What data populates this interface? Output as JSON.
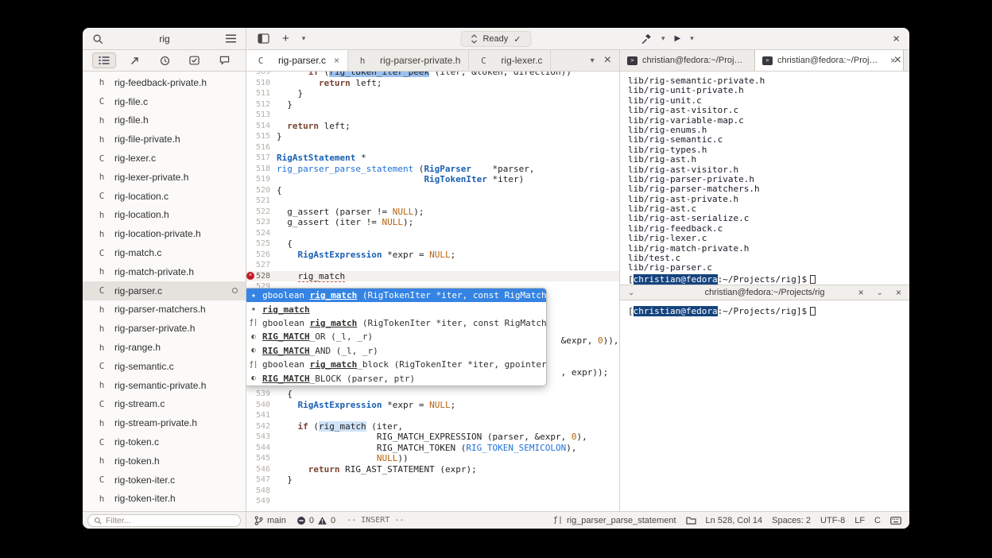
{
  "icons": {
    "plus": "+",
    "chevron": "▾",
    "chevron_small": "⌄",
    "run": "▶",
    "close": "×",
    "check": "✓",
    "star": "★",
    "function": "ƒ|",
    "macro": "◐",
    "prompt_char": ">"
  },
  "header": {
    "project": "rig",
    "ready": "Ready"
  },
  "sidebar": {
    "filter_placeholder": "Filter...",
    "selected": "rig-parser.c",
    "files": [
      {
        "type": "h",
        "name": "rig-feedback-private.h"
      },
      {
        "type": "C",
        "name": "rig-file.c"
      },
      {
        "type": "h",
        "name": "rig-file.h"
      },
      {
        "type": "h",
        "name": "rig-file-private.h"
      },
      {
        "type": "C",
        "name": "rig-lexer.c"
      },
      {
        "type": "h",
        "name": "rig-lexer-private.h"
      },
      {
        "type": "C",
        "name": "rig-location.c"
      },
      {
        "type": "h",
        "name": "rig-location.h"
      },
      {
        "type": "h",
        "name": "rig-location-private.h"
      },
      {
        "type": "C",
        "name": "rig-match.c"
      },
      {
        "type": "h",
        "name": "rig-match-private.h"
      },
      {
        "type": "C",
        "name": "rig-parser.c"
      },
      {
        "type": "h",
        "name": "rig-parser-matchers.h"
      },
      {
        "type": "h",
        "name": "rig-parser-private.h"
      },
      {
        "type": "h",
        "name": "rig-range.h"
      },
      {
        "type": "C",
        "name": "rig-semantic.c"
      },
      {
        "type": "h",
        "name": "rig-semantic-private.h"
      },
      {
        "type": "C",
        "name": "rig-stream.c"
      },
      {
        "type": "h",
        "name": "rig-stream-private.h"
      },
      {
        "type": "C",
        "name": "rig-token.c"
      },
      {
        "type": "h",
        "name": "rig-token.h"
      },
      {
        "type": "C",
        "name": "rig-token-iter.c"
      },
      {
        "type": "h",
        "name": "rig-token-iter.h"
      }
    ]
  },
  "editor": {
    "current_line": 528,
    "tabs": [
      {
        "icon": "C",
        "label": "rig-parser.c",
        "active": true,
        "close": true
      },
      {
        "icon": "h",
        "label": "rig-parser-private.h",
        "active": false,
        "close": false
      },
      {
        "icon": "C",
        "label": "rig-lexer.c",
        "active": false,
        "close": false
      }
    ],
    "lines": [
      {
        "n": 509,
        "s": [
          [
            "      ",
            ""
          ],
          [
            "if",
            "k"
          ],
          [
            " (",
            ""
          ],
          [
            "rig_token_iter_peek",
            "s"
          ],
          [
            " (iter, &token, direction))",
            ""
          ]
        ]
      },
      {
        "n": 510,
        "s": [
          [
            "        ",
            ""
          ],
          [
            "return",
            "k"
          ],
          [
            " left;",
            ""
          ]
        ]
      },
      {
        "n": 511,
        "s": [
          [
            "    }",
            ""
          ]
        ]
      },
      {
        "n": 512,
        "s": [
          [
            "  }",
            ""
          ]
        ]
      },
      {
        "n": 513,
        "s": []
      },
      {
        "n": 514,
        "s": [
          [
            "  ",
            ""
          ],
          [
            "return",
            "k"
          ],
          [
            " left;",
            ""
          ]
        ]
      },
      {
        "n": 515,
        "s": [
          [
            "}",
            ""
          ]
        ]
      },
      {
        "n": 516,
        "s": []
      },
      {
        "n": 517,
        "s": [
          [
            "RigAstStatement",
            "t"
          ],
          [
            " *",
            ""
          ]
        ]
      },
      {
        "n": 518,
        "s": [
          [
            "rig_parser_parse_statement",
            "f"
          ],
          [
            " (",
            ""
          ],
          [
            "RigParser",
            "t"
          ],
          [
            "    *parser,",
            ""
          ]
        ]
      },
      {
        "n": 519,
        "s": [
          [
            "                            ",
            ""
          ],
          [
            "RigTokenIter",
            "t"
          ],
          [
            " *iter)",
            ""
          ]
        ]
      },
      {
        "n": 520,
        "s": [
          [
            "{",
            ""
          ]
        ]
      },
      {
        "n": 521,
        "s": []
      },
      {
        "n": 522,
        "s": [
          [
            "  g_assert (parser != ",
            ""
          ],
          [
            "NULL",
            "c"
          ],
          [
            ");",
            ""
          ]
        ]
      },
      {
        "n": 523,
        "s": [
          [
            "  g_assert (iter != ",
            ""
          ],
          [
            "NULL",
            "c"
          ],
          [
            ");",
            ""
          ]
        ]
      },
      {
        "n": 524,
        "s": []
      },
      {
        "n": 525,
        "s": [
          [
            "  {",
            ""
          ]
        ]
      },
      {
        "n": 526,
        "s": [
          [
            "    ",
            ""
          ],
          [
            "RigAstExpression",
            "t"
          ],
          [
            " *expr = ",
            ""
          ],
          [
            "NULL",
            "c"
          ],
          [
            ";",
            ""
          ]
        ]
      },
      {
        "n": 527,
        "s": []
      },
      {
        "n": 528,
        "s": [
          [
            "    ",
            ""
          ],
          [
            "rig_match",
            "e"
          ]
        ]
      },
      {
        "n": 529,
        "s": []
      },
      {
        "n": 530,
        "s": []
      },
      {
        "n": 531,
        "s": []
      },
      {
        "n": 532,
        "s": []
      },
      {
        "n": 533,
        "s": []
      },
      {
        "n": 534,
        "s": [
          [
            "                                                      &expr, ",
            ""
          ],
          [
            "0",
            "c"
          ],
          [
            ")),",
            ""
          ]
        ]
      },
      {
        "n": 535,
        "s": []
      },
      {
        "n": 536,
        "s": []
      },
      {
        "n": 537,
        "s": [
          [
            "                                                      , expr));",
            ""
          ]
        ]
      },
      {
        "n": 538,
        "s": []
      },
      {
        "n": 539,
        "s": [
          [
            "  {",
            ""
          ]
        ]
      },
      {
        "n": 540,
        "s": [
          [
            "    ",
            ""
          ],
          [
            "RigAstExpression",
            "t"
          ],
          [
            " *expr = ",
            ""
          ],
          [
            "NULL",
            "c"
          ],
          [
            ";",
            ""
          ]
        ]
      },
      {
        "n": 541,
        "s": []
      },
      {
        "n": 542,
        "s": [
          [
            "    ",
            ""
          ],
          [
            "if",
            "k"
          ],
          [
            " (",
            ""
          ],
          [
            "rig_match",
            "o"
          ],
          [
            " (iter,",
            ""
          ]
        ]
      },
      {
        "n": 543,
        "s": [
          [
            "                   RIG_MATCH_EXPRESSION (parser, &expr, ",
            ""
          ],
          [
            "0",
            "c"
          ],
          [
            "),",
            ""
          ]
        ]
      },
      {
        "n": 544,
        "s": [
          [
            "                   RIG_MATCH_TOKEN (",
            ""
          ],
          [
            "RIG_TOKEN_SEMICOLON",
            "C"
          ],
          [
            "),",
            ""
          ]
        ]
      },
      {
        "n": 545,
        "s": [
          [
            "                   ",
            ""
          ],
          [
            "NULL",
            "c"
          ],
          [
            "))",
            ""
          ]
        ]
      },
      {
        "n": 546,
        "s": [
          [
            "      ",
            ""
          ],
          [
            "return",
            "k"
          ],
          [
            " RIG_AST_STATEMENT (expr);",
            ""
          ]
        ]
      },
      {
        "n": 547,
        "s": [
          [
            "  }",
            ""
          ]
        ]
      },
      {
        "n": 548,
        "s": []
      },
      {
        "n": 549,
        "s": []
      }
    ]
  },
  "popup": {
    "rows": [
      {
        "selected": true,
        "icon": "star",
        "prefix": "gboolean ",
        "match": "rig_match",
        "suffix": " (RigTokenIter *iter, const RigMatchOp *first_op, ...)"
      },
      {
        "selected": false,
        "icon": "star",
        "prefix": "",
        "match": "rig_match",
        "suffix": ""
      },
      {
        "selected": false,
        "icon": "function",
        "prefix": "gboolean ",
        "match": "rig_match",
        "suffix": " (RigTokenIter *iter, const RigMatchOp *first_op, ...)"
      },
      {
        "selected": false,
        "icon": "macro",
        "prefix": "",
        "match": "RIG_MATCH",
        "suffix": "_OR (_l, _r)"
      },
      {
        "selected": false,
        "icon": "macro",
        "prefix": "",
        "match": "RIG_MATCH",
        "suffix": "_AND (_l, _r)"
      },
      {
        "selected": false,
        "icon": "function",
        "prefix": "gboolean ",
        "match": "rig_match",
        "suffix": "_block (RigTokenIter *iter, gpointer user_data)"
      },
      {
        "selected": false,
        "icon": "macro",
        "prefix": "",
        "match": "RIG_MATCH",
        "suffix": "_BLOCK (parser, ptr)"
      }
    ]
  },
  "terminal": {
    "tabs": [
      {
        "title": "christian@fedora:~/Projects/rig",
        "active": false,
        "close": false
      },
      {
        "title": "christian@fedora:~/Projects/rig",
        "active": true,
        "close": true
      }
    ],
    "output": [
      "lib/rig-semantic-private.h",
      "lib/rig-unit-private.h",
      "lib/rig-unit.c",
      "lib/rig-ast-visitor.c",
      "lib/rig-variable-map.c",
      "lib/rig-enums.h",
      "lib/rig-semantic.c",
      "lib/rig-types.h",
      "lib/rig-ast.h",
      "lib/rig-ast-visitor.h",
      "lib/rig-parser-private.h",
      "lib/rig-parser-matchers.h",
      "lib/rig-ast-private.h",
      "lib/rig-ast.c",
      "lib/rig-ast-serialize.c",
      "lib/rig-feedback.c",
      "lib/rig-lexer.c",
      "lib/rig-match-private.h",
      "lib/test.c",
      "lib/rig-parser.c"
    ],
    "prompt": {
      "open": "[",
      "user": "christian@fedora",
      "rest": ":~/Projects/rig]$"
    },
    "pane2": {
      "title": "christian@fedora:~/Projects/rig"
    }
  },
  "statusbar": {
    "branch": "main",
    "errors": "0",
    "warnings": "0",
    "mode": "-- INSERT --",
    "symbol": "rig_parser_parse_statement",
    "position": "Ln 528, Col 14",
    "spaces": "Spaces: 2",
    "encoding": "UTF-8",
    "eol": "LF",
    "language": "C"
  }
}
